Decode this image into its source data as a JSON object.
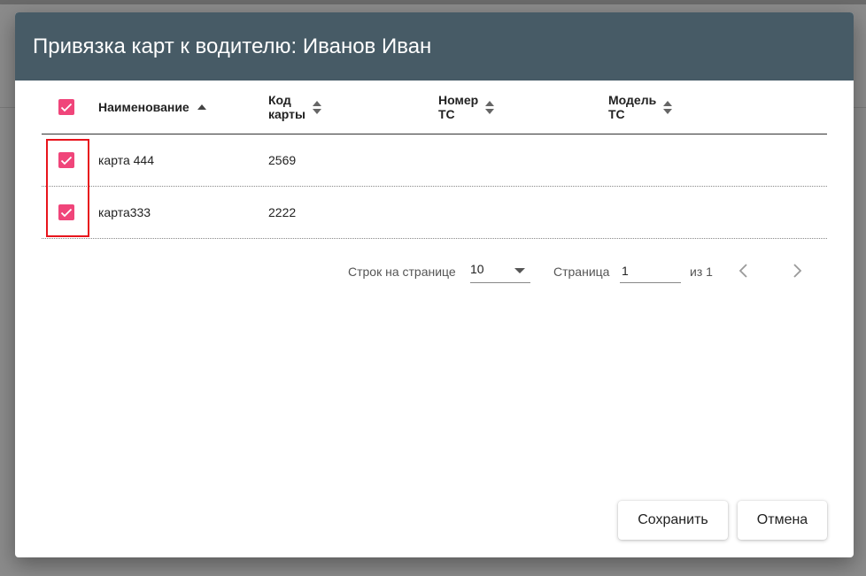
{
  "dialog": {
    "title": "Привязка карт к водителю: Иванов Иван"
  },
  "table": {
    "columns": [
      {
        "label": "Наименование",
        "sort": "asc"
      },
      {
        "label": "Код карты",
        "line1": "Код",
        "line2": "карты",
        "sort": "both"
      },
      {
        "label": "Номер ТС",
        "line1": "Номер",
        "line2": "ТС",
        "sort": "both"
      },
      {
        "label": "Модель ТС",
        "line1": "Модель",
        "line2": "ТС",
        "sort": "both"
      }
    ],
    "select_all_checked": true,
    "rows": [
      {
        "checked": true,
        "name": "карта 444",
        "code": "2569",
        "vehicle_number": "",
        "vehicle_model": ""
      },
      {
        "checked": true,
        "name": "карта333",
        "code": "2222",
        "vehicle_number": "",
        "vehicle_model": ""
      }
    ]
  },
  "pagination": {
    "rows_per_page_label": "Строк на странице",
    "rows_per_page_value": "10",
    "page_label": "Страница",
    "page_value": "1",
    "of_label": "из 1",
    "prev_icon": "chevron-left-icon",
    "next_icon": "chevron-right-icon"
  },
  "actions": {
    "save_label": "Сохранить",
    "cancel_label": "Отмена"
  },
  "colors": {
    "header_bg": "#475b66",
    "checkbox": "#f0457a",
    "highlight": "#e8141c"
  }
}
